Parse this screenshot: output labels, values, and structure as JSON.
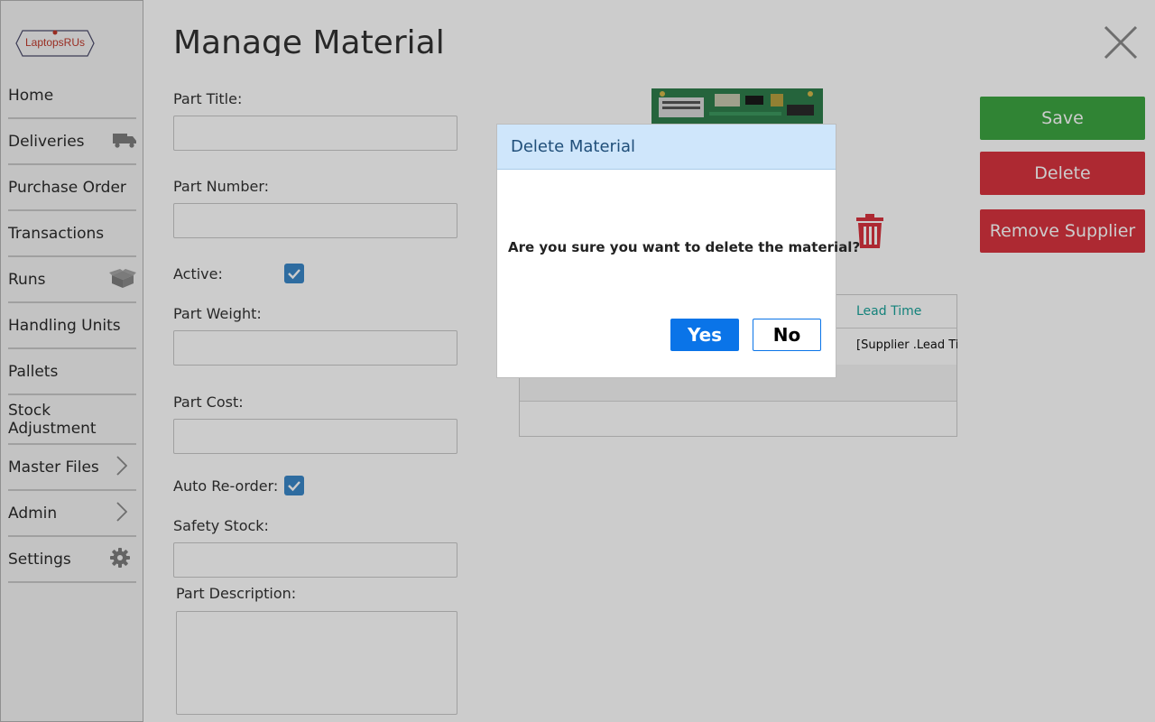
{
  "brand": {
    "logo_text": "LaptopsRUs"
  },
  "sidebar": {
    "items": [
      {
        "label": "Home",
        "icon": ""
      },
      {
        "label": "Deliveries",
        "icon": "truck-icon"
      },
      {
        "label": "Purchase Order",
        "icon": ""
      },
      {
        "label": "Transactions",
        "icon": ""
      },
      {
        "label": "Runs",
        "icon": "box-icon"
      },
      {
        "label": "Handling Units",
        "icon": ""
      },
      {
        "label": "Pallets",
        "icon": ""
      },
      {
        "label": "Stock Adjustment",
        "icon": ""
      },
      {
        "label": "Master Files",
        "icon": "chevron-right-icon"
      },
      {
        "label": "Admin",
        "icon": "chevron-right-icon"
      },
      {
        "label": "Settings",
        "icon": "gear-icon"
      }
    ]
  },
  "page": {
    "title": "Manage Material",
    "close_icon": "close-icon"
  },
  "form": {
    "part_title_label": "Part Title:",
    "part_title_value": "",
    "part_number_label": "Part Number:",
    "part_number_value": "",
    "active_label": "Active:",
    "active_checked": true,
    "part_weight_label": "Part Weight:",
    "part_weight_value": "",
    "part_cost_label": "Part Cost:",
    "part_cost_value": "",
    "auto_reorder_label": "Auto Re-order:",
    "auto_reorder_checked": true,
    "safety_stock_label": "Safety Stock:",
    "safety_stock_value": "",
    "part_description_label": "Part Description:",
    "part_description_value": ""
  },
  "suppliers_table": {
    "header_lead_time": "Lead Time",
    "row_lead_time": "[Supplier .Lead Ti"
  },
  "actions": {
    "save_label": "Save",
    "delete_label": "Delete",
    "remove_supplier_label": "Remove Supplier"
  },
  "dialog": {
    "title": "Delete Material",
    "message": "Are you sure you want to delete the material?",
    "yes_label": "Yes",
    "no_label": "No"
  },
  "colors": {
    "save": "#3da641",
    "delete": "#d9343f",
    "dialog_header": "#cfe6fb",
    "primary": "#0a74e8",
    "teal_header": "#1aa39a"
  }
}
